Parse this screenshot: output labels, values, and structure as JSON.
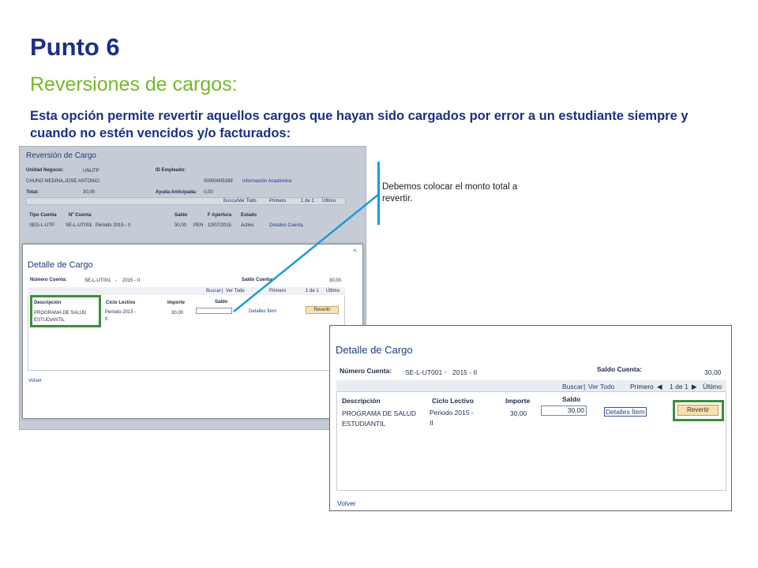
{
  "slide": {
    "title": "Punto 6",
    "subtitle": "Reversiones de cargos:",
    "intro": "Esta opción permite revertir aquellos cargos que hayan sido cargados por error a un estudiante siempre y cuando no estén vencidos y/o facturados:",
    "callout": "Debemos colocar el monto total a revertir."
  },
  "colors": {
    "title": "#1c2f86",
    "subtitle": "#76b82a",
    "callout_line": "#1f9ad6",
    "highlight": "#3c8e3b"
  },
  "reversion": {
    "title": "Reversión de Cargo",
    "unidad_label": "Unidad Negocio:",
    "unidad_value": "UNUTP",
    "student_name": "CHUNG MEDINA,JOSE ANTONIO",
    "total_label": "Total:",
    "total_value": "30,00",
    "id_label": "ID Empleado:",
    "id_value": "00000005189",
    "info_link": "Información Académica",
    "ayuda_label": "Ayuda Anticipada:",
    "ayuda_value": "0,00",
    "nav": {
      "buscar": "Buscar",
      "ver_todo": "Ver Todo",
      "primero": "Primero",
      "page": "1 de 1",
      "ultimo": "Último"
    },
    "columns": [
      "Tipo Cuenta",
      "Nº Cuenta",
      "Saldo",
      "F Apertura",
      "Estado"
    ],
    "row": {
      "tipo": "SEG-L-UTP",
      "cuenta": "SE-L-UT001",
      "dash": "-",
      "periodo": "Periodo 2015 - II",
      "saldo": "30,00",
      "moneda": "PEN",
      "fecha": "10/07/2015",
      "estado": "Activo",
      "link": "Detalles Cuenta"
    }
  },
  "detalle": {
    "title": "Detalle de Cargo",
    "close": "×",
    "numero_label": "Número Cuenta:",
    "numero_value": "SE-L-UT001",
    "dash": "-",
    "periodo": "2015 - II",
    "saldo_cuenta_label": "Saldo Cuenta:",
    "saldo_cuenta_value": "30,00",
    "nav": {
      "buscar": "Buscar",
      "sep": "|",
      "ver_todo": "Ver Todo",
      "primero": "Primero",
      "page": "1 de 1",
      "ultimo": "Último"
    },
    "columns": {
      "descripcion": "Descripción",
      "ciclo": "Ciclo Lectivo",
      "importe": "Importe",
      "saldo": "Saldo"
    },
    "row": {
      "desc_line1": "PROGRAMA DE SALUD",
      "desc_line2": "ESTUDIANTIL",
      "ciclo_line1": "Periodo 2015 -",
      "ciclo_line2": "II",
      "importe": "30,00",
      "saldo_input": "",
      "saldo_input_zoom": "30,00",
      "detalles": "Detalles Ítem",
      "revertir": "Revertir"
    },
    "volver": "Volver"
  }
}
